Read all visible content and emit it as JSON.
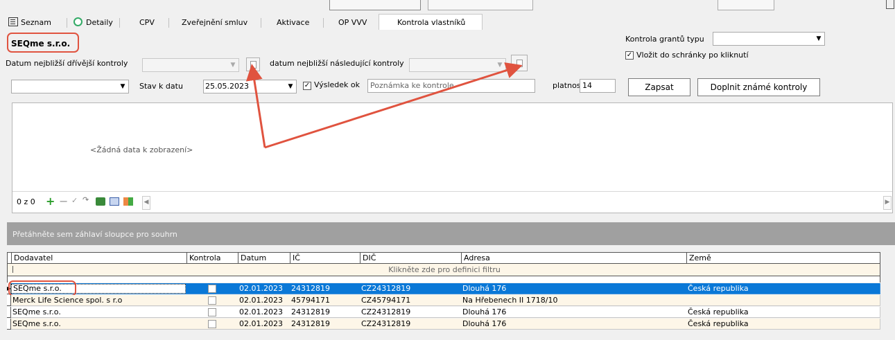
{
  "tabs": [
    {
      "label": "Seznam",
      "icon": "list-icon"
    },
    {
      "label": "Detaily",
      "icon": "magnifier-icon"
    },
    {
      "label": "CPV"
    },
    {
      "label": "Zveřejnění smluv"
    },
    {
      "label": "Aktivace"
    },
    {
      "label": "OP VVV"
    },
    {
      "label": "Kontrola vlastníků",
      "active": true
    }
  ],
  "form": {
    "company_name": "SEQme s.r.o.",
    "prev_check_label": "Datum nejbližší dřívější kontroly",
    "next_check_label": "datum nejbližší následující kontroly",
    "grant_check_label": "Kontrola grantů typu",
    "copy_clipboard_label": "Vložit do schránky po kliknutí",
    "stav_label": "Stav k datu",
    "stav_date": "25.05.2023",
    "result_label": "Výsledek ok",
    "note_placeholder": "Poznámka ke kontrole",
    "validity_label": "platnost",
    "validity_value": "14",
    "write_button": "Zapsat",
    "fill_button": "Doplnit známé kontroly"
  },
  "subgrid": {
    "empty_text": "<Žádná data k zobrazení>",
    "counter": "0 z 0"
  },
  "main_grid": {
    "group_hint": "Přetáhněte sem záhlaví sloupce pro souhrn",
    "filter_hint": "Klikněte zde pro definici filtru",
    "columns": [
      "Dodavatel",
      "Kontrola",
      "Datum",
      "IČ",
      "DIČ",
      "Adresa",
      "Země"
    ],
    "rows": [
      [
        "SEQme s.r.o.",
        "",
        "02.01.2023",
        "24312819",
        "CZ24312819",
        "Dlouhá 176",
        "Česká republika"
      ],
      [
        "Merck Life Science spol. s r.o",
        "",
        "02.01.2023",
        "45794171",
        "CZ45794171",
        "Na Hřebenech II 1718/10",
        ""
      ],
      [
        "SEQme s.r.o.",
        "",
        "02.01.2023",
        "24312819",
        "CZ24312819",
        "Dlouhá 176",
        "Česká republika"
      ],
      [
        "SEQme s.r.o.",
        "",
        "02.01.2023",
        "24312819",
        "CZ24312819",
        "Dlouhá 176",
        "Česká republika"
      ]
    ]
  },
  "colors": {
    "selection": "#0a78d7",
    "annotation": "#e0533f",
    "alt_row": "#fdf6e8"
  }
}
